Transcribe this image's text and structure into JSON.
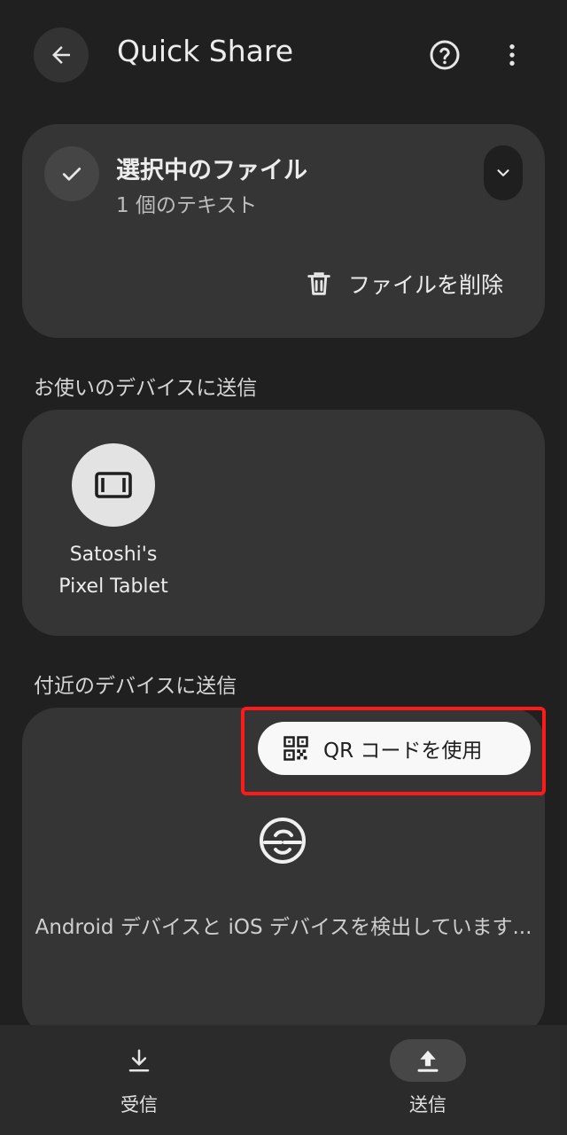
{
  "app_bar": {
    "title": "Quick Share",
    "back_icon": "arrow-left-icon",
    "help_icon": "help-circle-icon",
    "more_icon": "more-vert-icon"
  },
  "selected_files": {
    "title": "選択中のファイル",
    "subtitle": "1 個のテキスト",
    "delete_label": "ファイルを削除"
  },
  "your_devices": {
    "section_title": "お使いのデバイスに送信",
    "devices": [
      {
        "name": "Satoshi's Pixel Tablet",
        "icon": "tablet-icon"
      }
    ]
  },
  "nearby": {
    "section_title": "付近のデバイスに送信",
    "qr_button_label": "QR コードを使用",
    "status_text": "Android デバイスと iOS デバイスを検出しています..."
  },
  "bottom_nav": {
    "receive_label": "受信",
    "send_label": "送信",
    "selected": "send"
  },
  "colors": {
    "background": "#202020",
    "card": "#353535",
    "highlight": "#ff1a1a"
  }
}
